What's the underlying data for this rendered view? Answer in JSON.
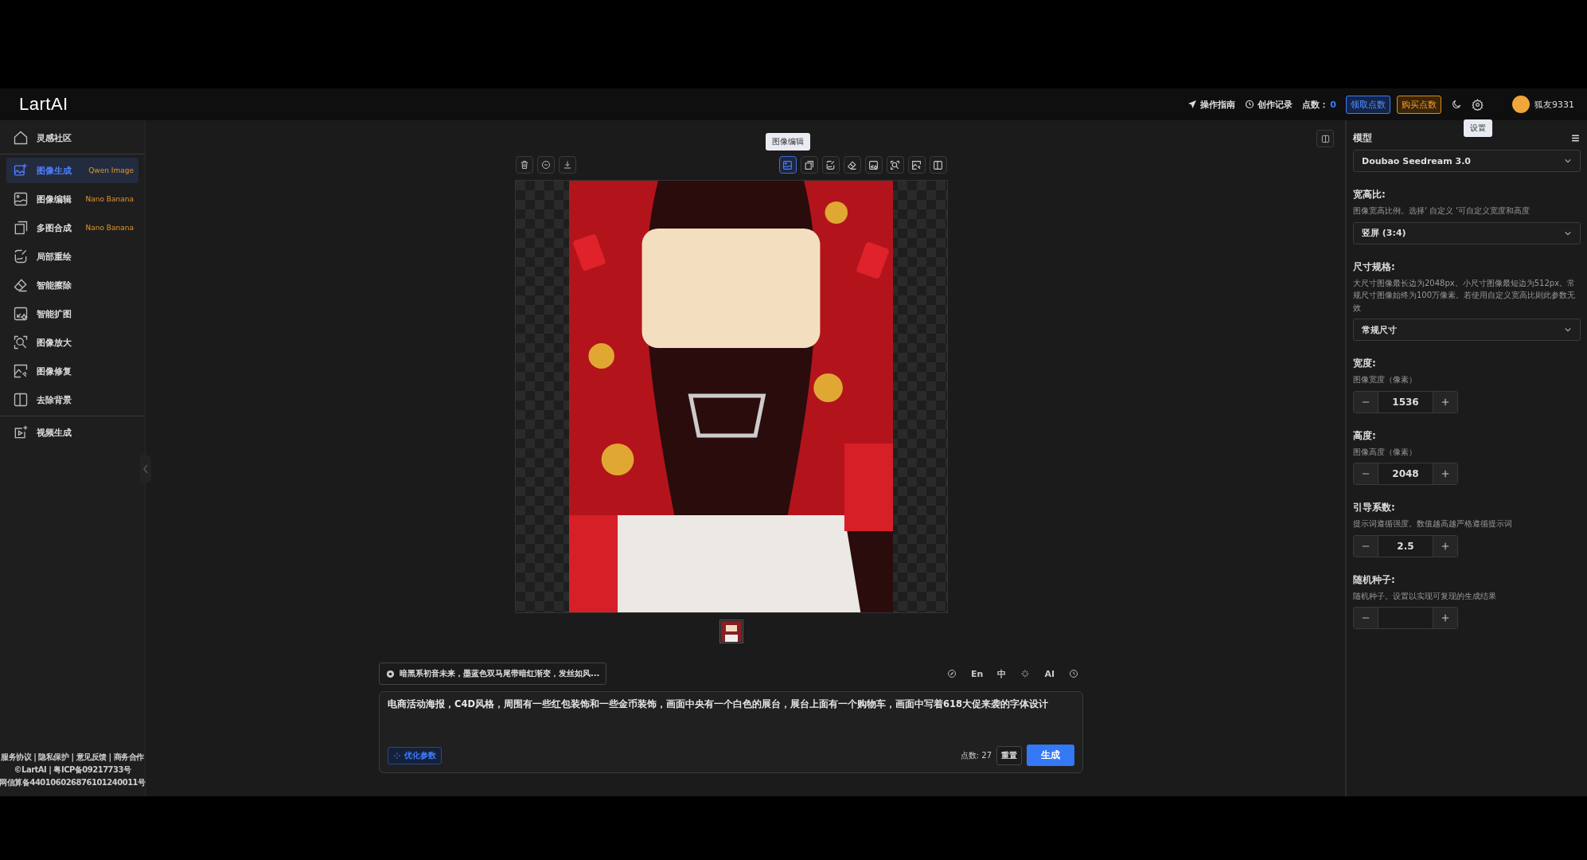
{
  "header": {
    "logo": "LartAI",
    "links": [
      {
        "label": "操作指南",
        "kind": "guide"
      },
      {
        "label": "创作记录",
        "kind": "history"
      }
    ],
    "points_label": "点数：",
    "points_value": "0",
    "claim_button": "领取点数",
    "buy_button": "购买点数",
    "user_name": "狐友9331",
    "settings_tooltip": "设置"
  },
  "sidebar": {
    "top_item": {
      "label": "灵感社区",
      "selected": false
    },
    "items": [
      {
        "label": "图像生成",
        "tag": "Qwen Image",
        "selected": true
      },
      {
        "label": "图像编辑",
        "tag": "Nano Banana",
        "selected": false
      },
      {
        "label": "多图合成",
        "tag": "Nano Banana",
        "selected": false
      },
      {
        "label": "局部重绘",
        "selected": false
      },
      {
        "label": "智能擦除",
        "selected": false
      },
      {
        "label": "智能扩图",
        "selected": false
      },
      {
        "label": "图像放大",
        "selected": false
      },
      {
        "label": "图像修复",
        "selected": false
      },
      {
        "label": "去除背景",
        "selected": false
      }
    ],
    "bottom_item": {
      "label": "视频生成",
      "selected": false
    },
    "footer": [
      "服务协议 | 隐私保护 | 意见反馈 | 商务合作",
      "©LartAI | 粤ICP备09217733号",
      "网信算备440106026876101240011号"
    ]
  },
  "toolbar": {
    "tooltip": "图像编辑",
    "tools": [
      {
        "selected": true
      },
      {
        "selected": false
      },
      {
        "selected": false
      },
      {
        "selected": false
      },
      {
        "selected": false
      },
      {
        "selected": false
      },
      {
        "selected": false
      },
      {
        "selected": false
      }
    ]
  },
  "prompt": {
    "history_chip": "暗黑系初音未来，墨蓝色双马尾带暗红渐变，发丝如风...",
    "tools": [
      {
        "kind": "icon"
      },
      {
        "kind": "text",
        "label": "En"
      },
      {
        "kind": "text",
        "label": "中"
      },
      {
        "kind": "icon"
      },
      {
        "kind": "text",
        "label": "AI"
      },
      {
        "kind": "icon"
      }
    ],
    "value": "电商活动海报，C4D风格，周围有一些红包装饰和一些金币装饰，画面中央有一个白色的展台，展台上面有一个购物车，画面中写着618大促来袭的字体设计",
    "optimize_button": "优化参数",
    "cost": "点数: 27",
    "reset_button": "重置",
    "generate_button": "生成"
  },
  "settings": [
    {
      "kind": "select",
      "label": "模型",
      "value": "Doubao Seedream 3.0"
    },
    {
      "kind": "select",
      "label": "宽高比:",
      "hint": "图像宽高比例。选择' 自定义 '可自定义宽度和高度",
      "value": "竖屏 (3:4)"
    },
    {
      "kind": "select",
      "label": "尺寸规格:",
      "hint": "大尺寸图像最长边为2048px。小尺寸图像最短边为512px。常规尺寸图像始终为100万像素。若使用自定义宽高比则此参数无效",
      "value": "常规尺寸"
    },
    {
      "kind": "number",
      "label": "宽度:",
      "hint": "图像宽度（像素）",
      "value": "1536"
    },
    {
      "kind": "number",
      "label": "高度:",
      "hint": "图像高度（像素）",
      "value": "2048"
    },
    {
      "kind": "number",
      "label": "引导系数:",
      "hint": "提示词遵循强度。数值越高越严格遵循提示词",
      "value": "2.5"
    },
    {
      "kind": "number",
      "label": "随机种子:",
      "hint": "随机种子。设置以实现可复现的生成结果"
    }
  ]
}
